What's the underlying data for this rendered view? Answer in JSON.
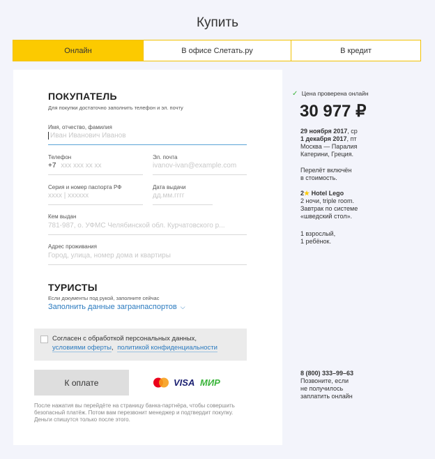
{
  "page": {
    "title": "Купить"
  },
  "tabs": [
    {
      "label": "Онлайн"
    },
    {
      "label": "В офисе Слетать.ру"
    },
    {
      "label": "В кредит"
    }
  ],
  "buyer": {
    "heading": "ПОКУПАТЕЛЬ",
    "hint": "Для покупки достаточно заполнить телефон и эл. почту",
    "name": {
      "label": "Имя, отчество, фамилия",
      "placeholder": "Иван Иванович Иванов"
    },
    "phone": {
      "label": "Телефон",
      "prefix": "+7",
      "placeholder": "xxx xxx xx xx"
    },
    "email": {
      "label": "Эл. почта",
      "placeholder": "ivanov-ivan@example.com"
    },
    "passport": {
      "label": "Серия и номер паспорта РФ",
      "placeholder": "xxxx | xxxxxx"
    },
    "issue_date": {
      "label": "Дата выдачи",
      "placeholder": "дд.мм.гггг"
    },
    "issued_by": {
      "label": "Кем выдан",
      "placeholder": "781-987, о. УФМС Челябинской обл. Курчатовского р..."
    },
    "address": {
      "label": "Адрес проживания",
      "placeholder": "Город, улица, номер дома и квартиры"
    }
  },
  "tourists": {
    "heading": "ТУРИСТЫ",
    "hint": "Если документы под рукой, заполните сейчас",
    "link": "Заполнить данные загранпаспортов"
  },
  "consent": {
    "text": "Согласен с обработкой персональных данных,",
    "link1": "условиями оферты",
    "sep": ",",
    "link2": "политикой конфиденциальности"
  },
  "payment": {
    "button": "К оплате",
    "visa": "VISA",
    "mir": "МИР",
    "note": "После нажатия вы перейдёте на страницу банка-партнёра, чтобы совершить безопасный платёж. Потом вам перезвонит менеджер и подтвердит покупку. Деньги спишутся только после этого."
  },
  "summary": {
    "verified": "Цена проверена онлайн",
    "price": "30 977 ₽",
    "date_from": "29 ноября 2017",
    "day_from": ", ср",
    "date_to": "1 декабря 2017",
    "day_to": ", пт",
    "route1": "Москва — Паралия",
    "route2": "Катерини, Греция.",
    "flight1": "Перелёт включён",
    "flight2": "в стоимость.",
    "stars": "2",
    "hotel": "Hotel Lego",
    "hotel1": "2 ночи, triple room.",
    "hotel2": "Завтрак по системе",
    "hotel3": "«шведский стол».",
    "pax1": "1 взрослый,",
    "pax2": "1 ребёнок."
  },
  "contact": {
    "phone": "8 (800) 333–99–63",
    "line1": "Позвоните, если",
    "line2": "не получилось",
    "line3": "заплатить онлайн"
  },
  "colors": {
    "accent": "#fcca00",
    "link": "#2a7abf",
    "check": "#3bb53b"
  }
}
